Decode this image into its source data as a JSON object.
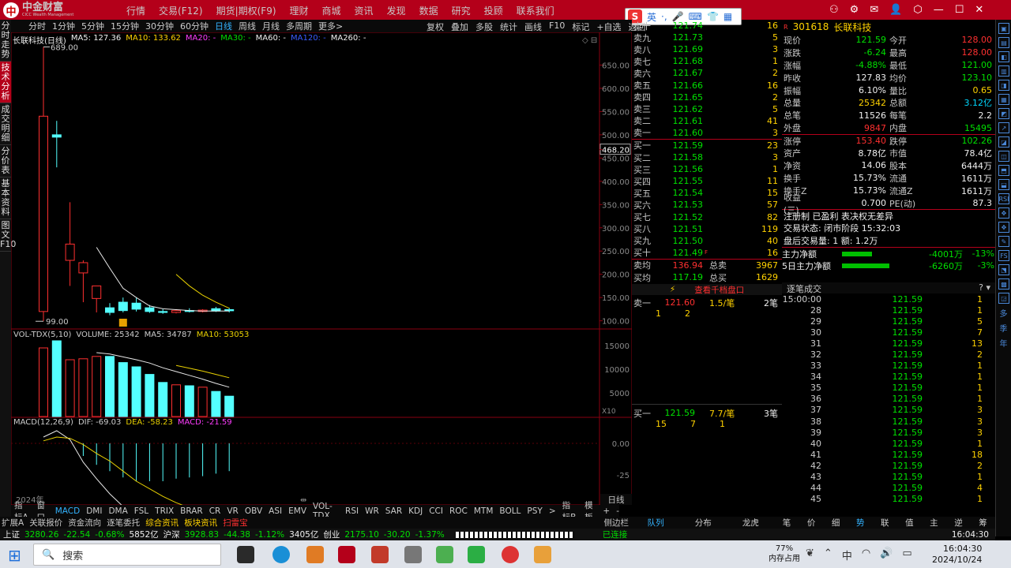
{
  "app": {
    "logo_title": "中金财富",
    "logo_sub": "CICC Wealth Management"
  },
  "menu": [
    "行情",
    "交易(F12)",
    "期货|期权(F9)",
    "理财",
    "商城",
    "资讯",
    "发现",
    "数据",
    "研究",
    "投顾",
    "联系我们"
  ],
  "ime": {
    "mode": "英"
  },
  "leftnav": [
    "分时走势",
    "技术分析",
    "成交明细",
    "分价表",
    "基本资料",
    "图文F10"
  ],
  "periods": [
    "分时",
    "1分钟",
    "5分钟",
    "15分钟",
    "30分钟",
    "60分钟",
    "日线",
    "周线",
    "月线",
    "多周期",
    "更多>"
  ],
  "period_active": "日线",
  "chart_tools": [
    "复权",
    "叠加",
    "多股",
    "统计",
    "画线",
    "F10",
    "标记",
    "+自选",
    "返回"
  ],
  "chart_title": {
    "name": "长联科技(日线)",
    "ma5": "MA5: 127.36",
    "ma10": "MA10: 133.62",
    "ma20": "MA20: -",
    "ma30": "MA30: -",
    "ma60": "MA60: -",
    "ma120": "MA120: -",
    "ma260": "MA260: -"
  },
  "price_axis": [
    "650.00",
    "600.00",
    "550.00",
    "500.00",
    "468.20",
    "450.00",
    "400.00",
    "350.00",
    "300.00",
    "250.00",
    "200.00",
    "150.00",
    "100.00"
  ],
  "price_hi_label": "689.00",
  "price_lo_label": "99.00",
  "vol_title": {
    "name": "VOL-TDX(5,10)",
    "volume": "VOLUME: 25342",
    "ma5": "MA5: 34787",
    "ma10": "MA10: 53053"
  },
  "vol_axis": [
    "15000",
    "10000",
    "5000",
    "X10"
  ],
  "macd_title": {
    "name": "MACD(12,26,9)",
    "dif": "DIF: -69.03",
    "dea": "DEA: -58.23",
    "macd": "MACD: -21.59"
  },
  "macd_axis": [
    "0.00",
    "-25"
  ],
  "year_label": "2024年",
  "chart_data": {
    "type": "candlestick",
    "unit": "price",
    "candles": [
      {
        "o": 120,
        "h": 689,
        "l": 99,
        "c": 540
      },
      {
        "o": 500,
        "h": 530,
        "l": 430,
        "c": 495
      },
      {
        "o": 230,
        "h": 355,
        "l": 175,
        "c": 265
      },
      {
        "o": 203,
        "h": 230,
        "l": 140,
        "c": 225
      },
      {
        "o": 148,
        "h": 160,
        "l": 118,
        "c": 175
      },
      {
        "o": 128,
        "h": 138,
        "l": 112,
        "c": 118
      },
      {
        "o": 140,
        "h": 150,
        "l": 118,
        "c": 122
      },
      {
        "o": 138,
        "h": 150,
        "l": 120,
        "c": 125
      },
      {
        "o": 128,
        "h": 134,
        "l": 117,
        "c": 120
      },
      {
        "o": 120,
        "h": 125,
        "l": 115,
        "c": 118
      },
      {
        "o": 118,
        "h": 125,
        "l": 116,
        "c": 122
      },
      {
        "o": 122,
        "h": 127,
        "l": 118,
        "c": 120
      },
      {
        "o": 120,
        "h": 125,
        "l": 118,
        "c": 123
      },
      {
        "o": 126,
        "h": 130,
        "l": 119,
        "c": 121
      },
      {
        "o": 124,
        "h": 128,
        "l": 118,
        "c": 121.59
      }
    ],
    "ma5": [
      null,
      null,
      null,
      null,
      258,
      213,
      170,
      150,
      132,
      126,
      124,
      122,
      121,
      121,
      121
    ],
    "ma10": [
      null,
      null,
      null,
      null,
      null,
      null,
      null,
      null,
      null,
      null,
      200,
      175,
      155,
      140,
      127
    ],
    "volume": [
      14500,
      16000,
      12000,
      12200,
      12700,
      12700,
      11400,
      10500,
      8900,
      7200,
      6700,
      6500,
      6200,
      5300,
      4300
    ],
    "vol_ma5": [
      null,
      null,
      null,
      null,
      13500,
      13200,
      12600,
      12000,
      11300,
      10300,
      9500,
      8700,
      7900,
      7000,
      6200
    ],
    "vol_ma10": [
      null,
      null,
      null,
      null,
      null,
      null,
      null,
      null,
      null,
      null,
      10800,
      10200,
      9600,
      8900,
      8200
    ],
    "macd_bars": [
      0,
      0,
      0,
      -10,
      -17,
      -22,
      -27,
      -30,
      -30,
      -30,
      -28,
      -27,
      -26,
      -24,
      -22
    ],
    "dif": [
      5,
      10,
      3,
      -15,
      -28,
      -40,
      -50,
      -58,
      -63,
      -66,
      -67,
      -68,
      -69,
      -69,
      -69
    ],
    "dea": [
      2,
      5,
      4,
      -1,
      -8,
      -14,
      -22,
      -30,
      -36,
      -42,
      -47,
      -51,
      -55,
      -57,
      -58
    ]
  },
  "orderbook": {
    "asks": [
      {
        "l": "卖十",
        "p": "121.74",
        "v": "16"
      },
      {
        "l": "卖九",
        "p": "121.73",
        "v": "5"
      },
      {
        "l": "卖八",
        "p": "121.69",
        "v": "3"
      },
      {
        "l": "卖七",
        "p": "121.68",
        "v": "1"
      },
      {
        "l": "卖六",
        "p": "121.67",
        "v": "2"
      },
      {
        "l": "卖五",
        "p": "121.66",
        "v": "16"
      },
      {
        "l": "卖四",
        "p": "121.65",
        "v": "2"
      },
      {
        "l": "卖三",
        "p": "121.62",
        "v": "5"
      },
      {
        "l": "卖二",
        "p": "121.61",
        "v": "41"
      },
      {
        "l": "卖一",
        "p": "121.60",
        "v": "3"
      }
    ],
    "bids": [
      {
        "l": "买一",
        "p": "121.59",
        "v": "23"
      },
      {
        "l": "买二",
        "p": "121.58",
        "v": "3"
      },
      {
        "l": "买三",
        "p": "121.56",
        "v": "1"
      },
      {
        "l": "买四",
        "p": "121.55",
        "v": "11"
      },
      {
        "l": "买五",
        "p": "121.54",
        "v": "15"
      },
      {
        "l": "买六",
        "p": "121.53",
        "v": "57"
      },
      {
        "l": "买七",
        "p": "121.52",
        "v": "82"
      },
      {
        "l": "买八",
        "p": "121.51",
        "v": "119"
      },
      {
        "l": "买九",
        "p": "121.50",
        "v": "40"
      },
      {
        "l": "买十",
        "p": "121.49",
        "v": "16"
      }
    ],
    "avg_sell": {
      "l": "卖均",
      "p": "136.94",
      "k": "总卖",
      "v": "3967"
    },
    "avg_buy": {
      "l": "买均",
      "p": "117.19",
      "k": "总买",
      "v": "1629"
    },
    "view_thousand": "查看千档盘口",
    "queue_sell": {
      "l": "卖一",
      "p": "121.60",
      "r": "1.5/笔",
      "n": "2笔",
      "items": [
        "1",
        "2"
      ]
    },
    "queue_buy": {
      "l": "买一",
      "p": "121.59",
      "r": "7.7/笔",
      "n": "3笔",
      "items": [
        "15",
        "7",
        "1"
      ]
    }
  },
  "stock": {
    "code": "301618",
    "name": "长联科技",
    "rows": [
      [
        "现价",
        "121.59",
        "今开",
        "128.00"
      ],
      [
        "涨跌",
        "-6.24",
        "最高",
        "128.00"
      ],
      [
        "涨幅",
        "-4.88%",
        "最低",
        "121.00"
      ],
      [
        "昨收",
        "127.83",
        "均价",
        "123.10"
      ],
      [
        "振幅",
        "6.10%",
        "量比",
        "0.65"
      ],
      [
        "总量",
        "25342",
        "总额",
        "3.12亿"
      ],
      [
        "总笔",
        "11526",
        "每笔",
        "2.2"
      ],
      [
        "外盘",
        "9847",
        "内盘",
        "15495"
      ],
      [
        "涨停",
        "153.40",
        "跌停",
        "102.26"
      ],
      [
        "资产",
        "8.78亿",
        "市值",
        "78.4亿"
      ],
      [
        "净资",
        "14.06",
        "股本",
        "6444万"
      ],
      [
        "换手",
        "15.73%",
        "流通",
        "1611万"
      ],
      [
        "换手Z",
        "15.73%",
        "流通Z",
        "1611万"
      ],
      [
        "收益(三)",
        "0.700",
        "PE(动)",
        "87.3"
      ]
    ],
    "reg": "注册制 已盈利 表决权无差异",
    "trade_state": "交易状态: 闭市阶段 15:32:03",
    "after_hours": "盘后交易量: 1  额: 1.2万",
    "main_net": {
      "k": "主力净额",
      "v": "-4001万",
      "pct": "-13%"
    },
    "main_net5": {
      "k": "5日主力净额",
      "v": "-6260万",
      "pct": "-3%"
    }
  },
  "trades_title": "逐笔成交",
  "trades": [
    [
      "15:00:00",
      "121.59",
      "1"
    ],
    [
      "28",
      "121.59",
      "1"
    ],
    [
      "29",
      "121.59",
      "5"
    ],
    [
      "30",
      "121.59",
      "7"
    ],
    [
      "31",
      "121.59",
      "13"
    ],
    [
      "32",
      "121.59",
      "2"
    ],
    [
      "33",
      "121.59",
      "1"
    ],
    [
      "34",
      "121.59",
      "1"
    ],
    [
      "35",
      "121.59",
      "1"
    ],
    [
      "36",
      "121.59",
      "1"
    ],
    [
      "37",
      "121.59",
      "3"
    ],
    [
      "38",
      "121.59",
      "3"
    ],
    [
      "39",
      "121.59",
      "3"
    ],
    [
      "40",
      "121.59",
      "1"
    ],
    [
      "41",
      "121.59",
      "18"
    ],
    [
      "42",
      "121.59",
      "2"
    ],
    [
      "43",
      "121.59",
      "1"
    ],
    [
      "44",
      "121.59",
      "4"
    ],
    [
      "45",
      "121.59",
      "1"
    ]
  ],
  "ind_tabs": [
    "指标A",
    "窗口",
    "MACD",
    "DMI",
    "DMA",
    "FSL",
    "TRIX",
    "BRAR",
    "CR",
    "VR",
    "OBV",
    "ASI",
    "EMV",
    "VOL-TDX",
    "RSI",
    "WR",
    "SAR",
    "KDJ",
    "CCI",
    "ROC",
    "MTM",
    "BOLL",
    "PSY",
    ">",
    "指标B",
    "模板",
    "+",
    "-"
  ],
  "ind_active": "MACD",
  "right_axis_tab": "日线",
  "bottom_tabs": [
    "扩展A",
    "关联报价",
    "资金流向",
    "逐笔委托",
    "综合资讯",
    "板块资讯",
    "扫雷宝"
  ],
  "sidebar_label": "侧边栏",
  "bottom_tabs2": [
    "队列",
    "分布",
    "龙虎",
    "笔",
    "价",
    "细",
    "势",
    "联",
    "值",
    "主",
    "逆",
    "筹"
  ],
  "status": {
    "sh": "上证",
    "sh_v": "3280.26",
    "sh_c": "-22.54",
    "sh_p": "-0.68%",
    "sh_a": "5852亿",
    "hs": "沪深",
    "hs_v": "3928.83",
    "hs_c": "-44.38",
    "hs_p": "-1.12%",
    "hs_a": "3405亿",
    "cy": "创业",
    "cy_v": "2175.10",
    "cy_c": "-30.20",
    "cy_p": "-1.37%",
    "conn": "已连接",
    "time": "16:04:30"
  },
  "taskbar": {
    "search": "搜索",
    "mem_pct": "77%",
    "mem_label": "内存占用",
    "time": "16:04:30",
    "date": "2024/10/24"
  }
}
